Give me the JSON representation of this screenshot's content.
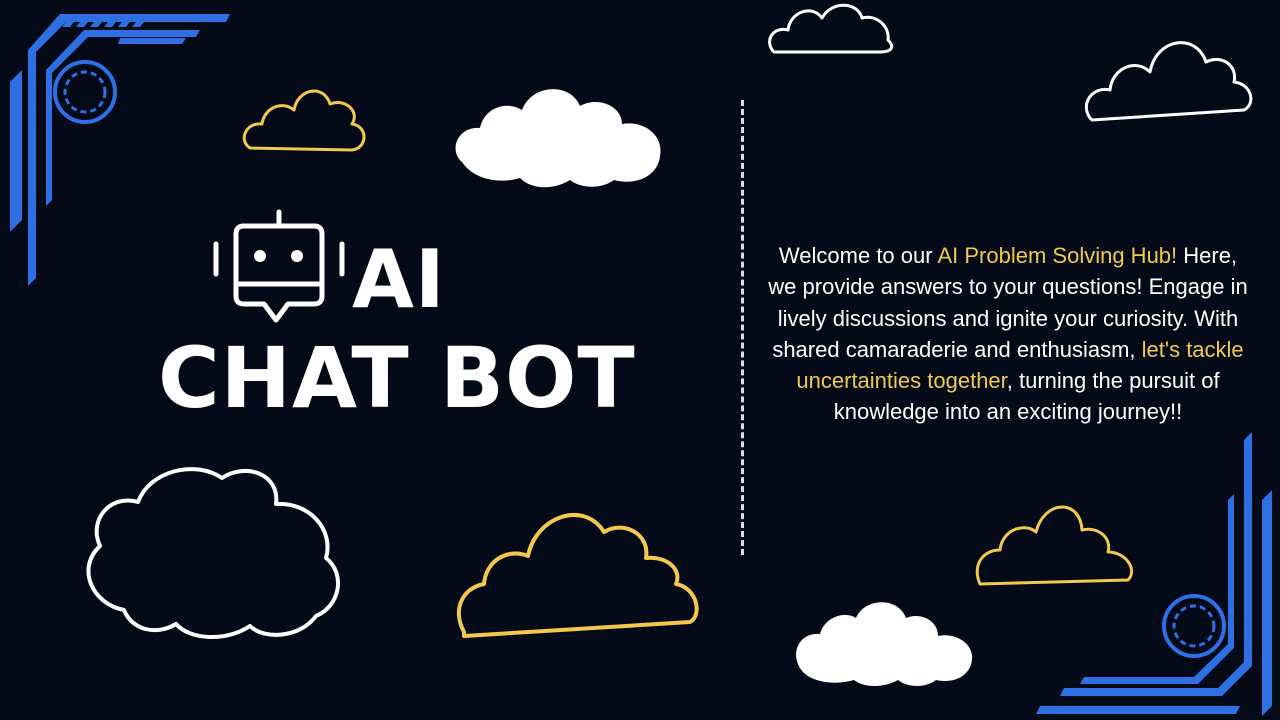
{
  "colors": {
    "background": "#050a18",
    "accent_blue": "#2f6fe4",
    "accent_yellow": "#f2c94c",
    "text": "#ffffff"
  },
  "title": {
    "line1": "AI",
    "line2": "CHAT BOT",
    "icon": "robot-chat-icon"
  },
  "description": {
    "part1": "Welcome to our ",
    "highlight1": "AI Problem Solving Hub!",
    "part2": " Here, we provide answers to your questions! Engage in lively discussions and ignite your curiosity. With shared camaraderie and enthusiasm, ",
    "highlight2": "let's tackle uncertainties together",
    "part3": ", turning the pursuit of knowledge into an exciting journey!!"
  },
  "decorations": {
    "clouds": [
      "cloud-icon"
    ],
    "corners": [
      "circuit-corner-icon"
    ]
  }
}
